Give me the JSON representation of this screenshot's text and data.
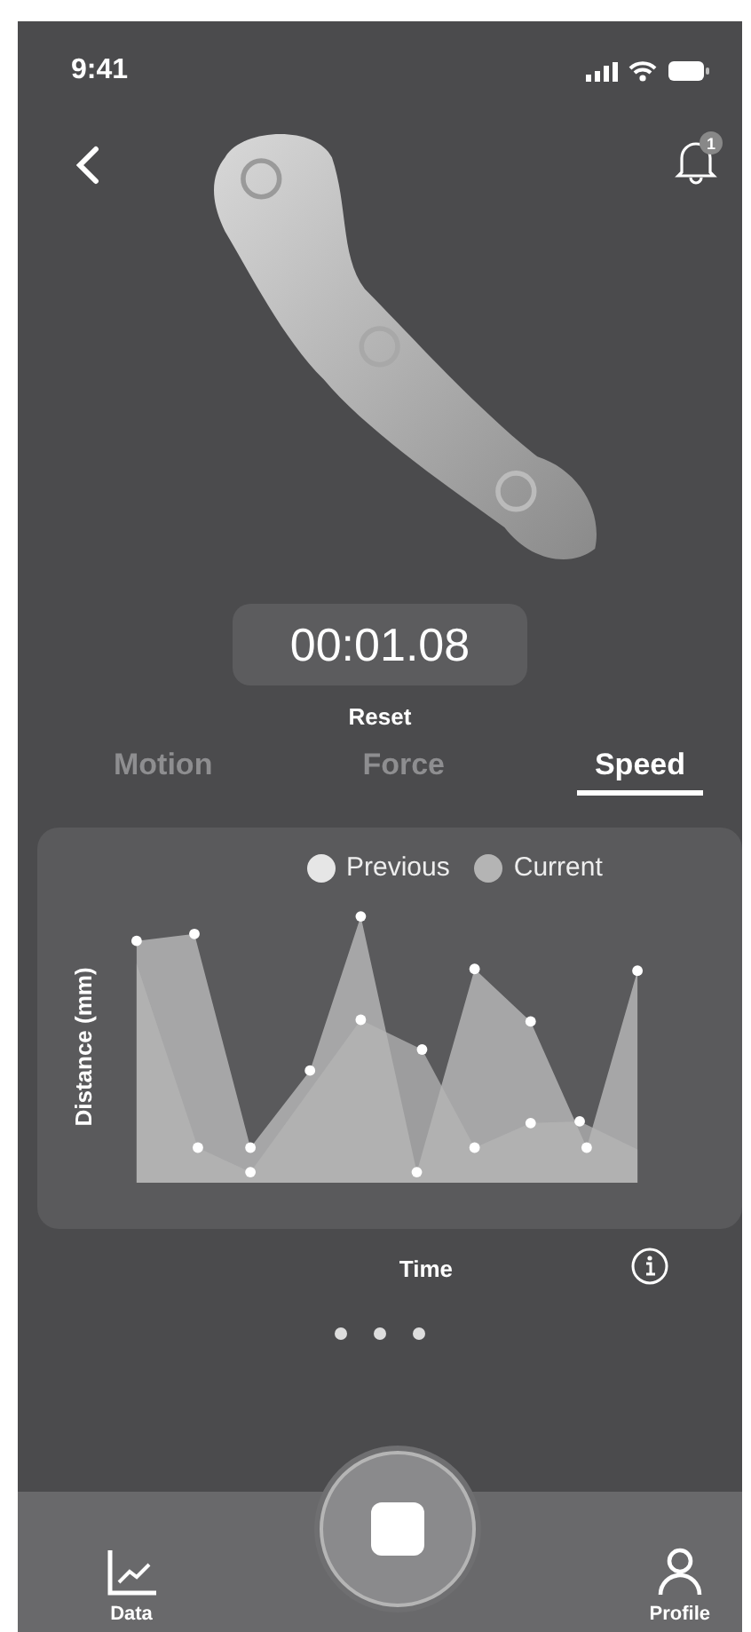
{
  "status_bar": {
    "time": "9:41"
  },
  "header": {
    "notification_count": "1"
  },
  "timer": {
    "value": "00:01.08",
    "reset_label": "Reset"
  },
  "tabs": [
    {
      "label": "Motion",
      "selected": false
    },
    {
      "label": "Force",
      "selected": false
    },
    {
      "label": "Speed",
      "selected": true
    }
  ],
  "chart": {
    "legend": [
      {
        "label": "Previous",
        "color": "#e6e6e6"
      },
      {
        "label": "Current",
        "color": "#b4b4b4"
      }
    ],
    "ylabel": "Distance (mm)",
    "xlabel": "Time"
  },
  "nav": [
    {
      "label": "Data",
      "kind": "data"
    },
    {
      "kind": "record"
    },
    {
      "label": "Profile",
      "kind": "profile"
    }
  ]
}
